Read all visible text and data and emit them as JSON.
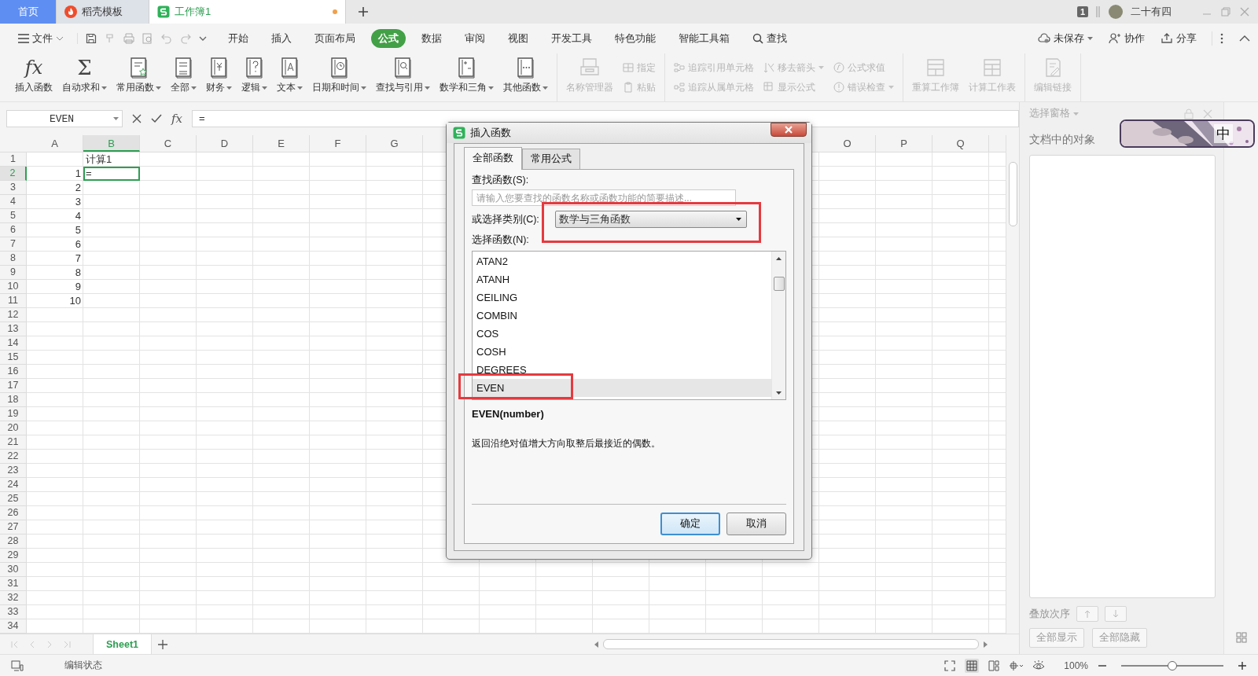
{
  "tabs": [
    {
      "label": "首页",
      "kind": "home",
      "selected": false
    },
    {
      "label": "稻壳模板",
      "kind": "docer",
      "selected": false
    },
    {
      "label": "工作簿1",
      "kind": "sheet",
      "selected": true,
      "unsaved": true
    }
  ],
  "account": {
    "badge": "1",
    "name": "二十有四"
  },
  "menu": {
    "file": "文件",
    "tabs": [
      {
        "label": "开始",
        "selected": false
      },
      {
        "label": "插入",
        "selected": false
      },
      {
        "label": "页面布局",
        "selected": false
      },
      {
        "label": "公式",
        "selected": true
      },
      {
        "label": "数据",
        "selected": false
      },
      {
        "label": "审阅",
        "selected": false
      },
      {
        "label": "视图",
        "selected": false
      },
      {
        "label": "开发工具",
        "selected": false
      },
      {
        "label": "特色功能",
        "selected": false
      },
      {
        "label": "智能工具箱",
        "selected": false
      }
    ],
    "search": "查找",
    "actions": [
      {
        "label": "未保存",
        "dropdown": true
      },
      {
        "label": "协作",
        "dropdown": false
      },
      {
        "label": "分享",
        "dropdown": false
      }
    ]
  },
  "ribbon": {
    "groups": [
      {
        "items": [
          {
            "kind": "large",
            "glyph": "fx",
            "label": "插入函数",
            "dropdown": false,
            "disabled": false
          },
          {
            "kind": "large",
            "glyph": "Σ",
            "label": "自动求和",
            "dropdown": true,
            "disabled": false
          },
          {
            "kind": "large",
            "label": "常用函数",
            "dropdown": true,
            "disabled": false
          },
          {
            "kind": "large",
            "label": "全部",
            "dropdown": true,
            "disabled": false
          },
          {
            "kind": "large",
            "label": "财务",
            "dropdown": true,
            "disabled": false
          },
          {
            "kind": "large",
            "label": "逻辑",
            "dropdown": true,
            "disabled": false
          },
          {
            "kind": "large",
            "label": "文本",
            "dropdown": true,
            "disabled": false
          },
          {
            "kind": "large",
            "label": "日期和时间",
            "dropdown": true,
            "disabled": false
          },
          {
            "kind": "large",
            "label": "查找与引用",
            "dropdown": true,
            "disabled": false
          },
          {
            "kind": "large",
            "label": "数学和三角",
            "dropdown": true,
            "disabled": false
          },
          {
            "kind": "large",
            "label": "其他函数",
            "dropdown": true,
            "disabled": false
          }
        ]
      },
      {
        "items": [
          {
            "kind": "large",
            "label": "名称管理器",
            "dropdown": false,
            "disabled": true
          },
          {
            "kind": "stack",
            "items": [
              {
                "label": "指定",
                "dropdown": false,
                "disabled": true
              },
              {
                "label": "粘贴",
                "dropdown": false,
                "disabled": true
              }
            ]
          }
        ]
      },
      {
        "items": [
          {
            "kind": "stack",
            "items": [
              {
                "label": "追踪引用单元格",
                "dropdown": false,
                "disabled": true
              },
              {
                "label": "追踪从属单元格",
                "dropdown": false,
                "disabled": true
              }
            ]
          },
          {
            "kind": "stack",
            "items": [
              {
                "label": "移去箭头",
                "dropdown": true,
                "disabled": true
              },
              {
                "label": "显示公式",
                "dropdown": false,
                "disabled": true
              }
            ]
          },
          {
            "kind": "stack",
            "items": [
              {
                "label": "公式求值",
                "dropdown": false,
                "disabled": true
              },
              {
                "label": "错误检查",
                "dropdown": true,
                "disabled": true
              }
            ]
          }
        ]
      },
      {
        "items": [
          {
            "kind": "large",
            "label": "重算工作簿",
            "dropdown": false,
            "disabled": true
          },
          {
            "kind": "large",
            "label": "计算工作表",
            "dropdown": false,
            "disabled": true
          }
        ]
      },
      {
        "items": [
          {
            "kind": "large",
            "label": "编辑链接",
            "dropdown": false,
            "disabled": true
          }
        ]
      }
    ]
  },
  "formula_bar": {
    "name_box": "EVEN",
    "fx": "fx",
    "formula": "="
  },
  "sheet": {
    "columns_left": [
      {
        "label": "A",
        "selected": false
      },
      {
        "label": "B",
        "selected": true
      },
      {
        "label": "C",
        "selected": false
      },
      {
        "label": "D",
        "selected": false
      },
      {
        "label": "E",
        "selected": false
      },
      {
        "label": "F",
        "selected": false
      },
      {
        "label": "G",
        "selected": false
      }
    ],
    "columns_right": [
      {
        "label": "O",
        "selected": false
      },
      {
        "label": "P",
        "selected": false
      },
      {
        "label": "Q",
        "selected": false
      }
    ],
    "rows": [
      {
        "label": "1",
        "selected": false,
        "cells": [
          {
            "selected": false
          },
          {
            "text": "计算1",
            "kind": "text",
            "selected": false
          }
        ]
      },
      {
        "label": "2",
        "selected": true,
        "cells": [
          {
            "text": "1",
            "kind": "number",
            "selected": false
          },
          {
            "text": "=",
            "kind": "text",
            "selected": true
          }
        ]
      },
      {
        "label": "3",
        "selected": false,
        "cells": [
          {
            "text": "2",
            "kind": "number",
            "selected": false
          }
        ]
      },
      {
        "label": "4",
        "selected": false,
        "cells": [
          {
            "text": "3",
            "kind": "number",
            "selected": false
          }
        ]
      },
      {
        "label": "5",
        "selected": false,
        "cells": [
          {
            "text": "4",
            "kind": "number",
            "selected": false
          }
        ]
      },
      {
        "label": "6",
        "selected": false,
        "cells": [
          {
            "text": "5",
            "kind": "number",
            "selected": false
          }
        ]
      },
      {
        "label": "7",
        "selected": false,
        "cells": [
          {
            "text": "6",
            "kind": "number",
            "selected": false
          }
        ]
      },
      {
        "label": "8",
        "selected": false,
        "cells": [
          {
            "text": "7",
            "kind": "number",
            "selected": false
          }
        ]
      },
      {
        "label": "9",
        "selected": false,
        "cells": [
          {
            "text": "8",
            "kind": "number",
            "selected": false
          }
        ]
      },
      {
        "label": "10",
        "selected": false,
        "cells": [
          {
            "text": "9",
            "kind": "number",
            "selected": false
          }
        ]
      },
      {
        "label": "11",
        "selected": false,
        "cells": [
          {
            "text": "10",
            "kind": "number",
            "selected": false
          }
        ]
      },
      {
        "label": "12",
        "selected": false
      },
      {
        "label": "13",
        "selected": false
      },
      {
        "label": "14",
        "selected": false
      },
      {
        "label": "15",
        "selected": false
      },
      {
        "label": "16",
        "selected": false
      },
      {
        "label": "17",
        "selected": false
      },
      {
        "label": "18",
        "selected": false
      },
      {
        "label": "19",
        "selected": false
      },
      {
        "label": "20",
        "selected": false
      },
      {
        "label": "21",
        "selected": false
      },
      {
        "label": "22",
        "selected": false
      },
      {
        "label": "23",
        "selected": false
      },
      {
        "label": "24",
        "selected": false
      },
      {
        "label": "25",
        "selected": false
      },
      {
        "label": "26",
        "selected": false
      },
      {
        "label": "27",
        "selected": false
      },
      {
        "label": "28",
        "selected": false
      },
      {
        "label": "29",
        "selected": false
      },
      {
        "label": "30",
        "selected": false
      },
      {
        "label": "31",
        "selected": false
      },
      {
        "label": "32",
        "selected": false
      },
      {
        "label": "33",
        "selected": false
      },
      {
        "label": "34",
        "selected": false
      }
    ]
  },
  "sheet_tabs": [
    {
      "label": "Sheet1",
      "selected": true
    }
  ],
  "side_panel": {
    "title": "选择窗格",
    "heading": "文档中的对象",
    "order_label": "叠放次序",
    "buttons": [
      "全部显示",
      "全部隐藏"
    ]
  },
  "ime": {
    "label": "中"
  },
  "status_bar": {
    "mode": "编辑状态",
    "zoom": "100%",
    "zoom_slider": {
      "level": 0.5
    }
  },
  "dialog": {
    "title": "插入函数",
    "tabs": [
      {
        "label": "全部函数",
        "selected": true
      },
      {
        "label": "常用公式",
        "selected": false
      }
    ],
    "search": {
      "label": "查找函数(S):",
      "placeholder": "请输入您要查找的函数名称或函数功能的简要描述..."
    },
    "category": {
      "label": "或选择类别(C):",
      "value": "数学与三角函数",
      "annotated": true
    },
    "list_label": "选择函数(N):",
    "functions": [
      {
        "label": "ATAN2",
        "selected": false,
        "annotated": false
      },
      {
        "label": "ATANH",
        "selected": false,
        "annotated": false
      },
      {
        "label": "CEILING",
        "selected": false,
        "annotated": false
      },
      {
        "label": "COMBIN",
        "selected": false,
        "annotated": false
      },
      {
        "label": "COS",
        "selected": false,
        "annotated": false
      },
      {
        "label": "COSH",
        "selected": false,
        "annotated": false
      },
      {
        "label": "DEGREES",
        "selected": false,
        "annotated": false
      },
      {
        "label": "EVEN",
        "selected": true,
        "annotated": true
      }
    ],
    "signature": "EVEN(number)",
    "description": "返回沿绝对值增大方向取整后最接近的偶数。",
    "buttons": [
      {
        "label": "确定",
        "default": true
      },
      {
        "label": "取消",
        "default": false
      }
    ]
  }
}
